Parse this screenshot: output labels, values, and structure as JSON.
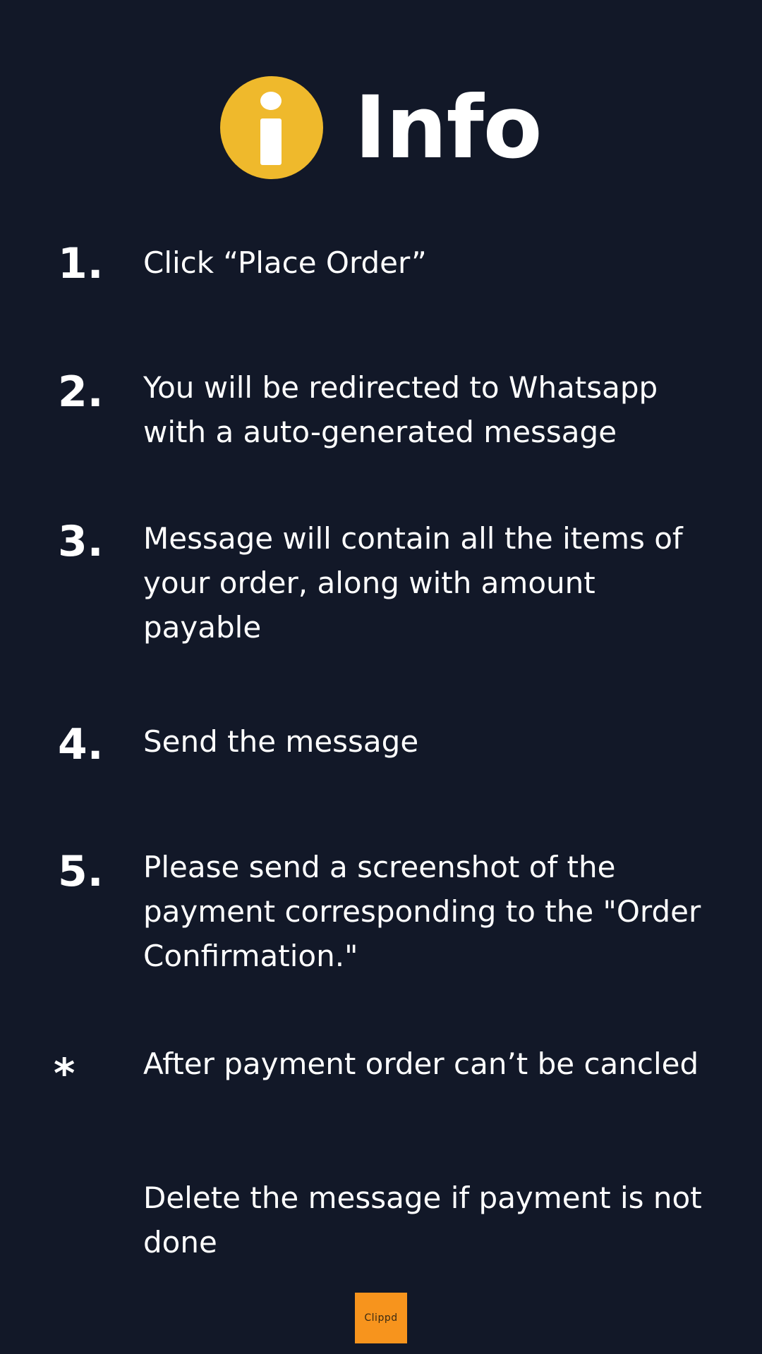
{
  "header": {
    "title": "Info",
    "icon": "info-icon",
    "icon_color": "#efb92c"
  },
  "steps": [
    {
      "number": "1.",
      "text": "Click “Place Order”"
    },
    {
      "number": "2.",
      "text": "You will be redirected to Whatsapp with a auto-generated message"
    },
    {
      "number": "3.",
      "text": "Message will contain all the items of your order, along with amount payable"
    },
    {
      "number": "4.",
      "text": "Send the message"
    },
    {
      "number": "5.",
      "text": "Please send a screenshot of the payment corresponding to the \"Order Confirmation.\""
    }
  ],
  "note": {
    "mark": "*",
    "lines": [
      "After payment order can’t be cancled",
      "Delete the message if payment is not done"
    ]
  },
  "watermark": {
    "text": "Clippd",
    "color": "#f7941d"
  },
  "colors": {
    "background": "#121828",
    "text": "#ffffff"
  }
}
